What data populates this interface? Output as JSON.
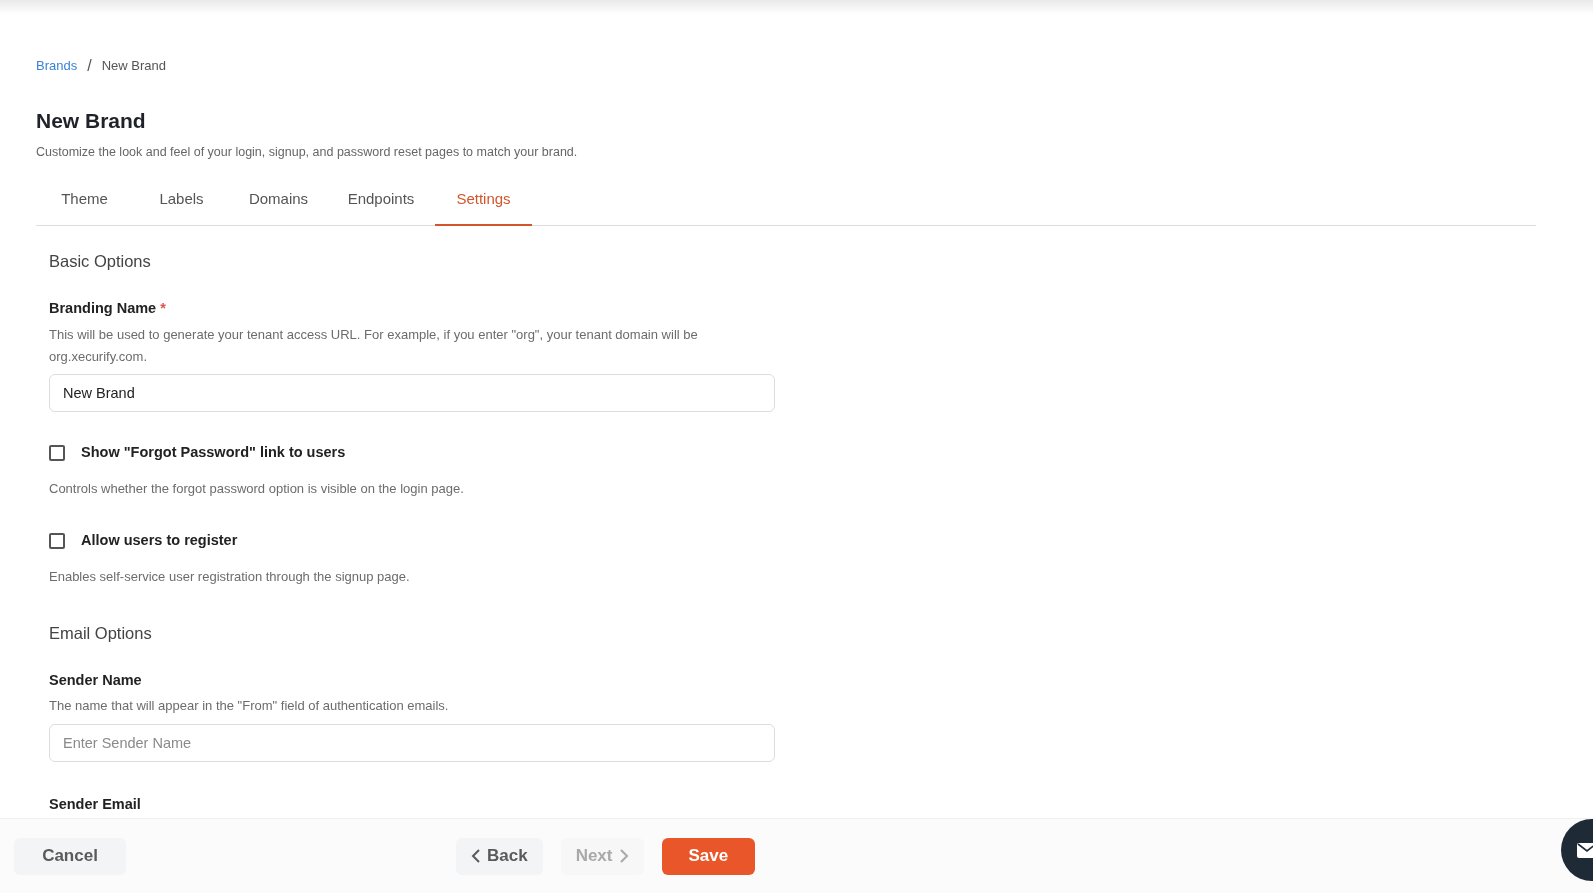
{
  "breadcrumb": [
    {
      "label": "Brands",
      "kind": "link"
    },
    {
      "label": "/",
      "kind": "separator"
    },
    {
      "label": "New Brand",
      "kind": "current"
    }
  ],
  "title": "New Brand",
  "subtitle": "Customize the look and feel of your login, signup, and password reset pages to match your brand.",
  "tabs": [
    {
      "label": "Theme",
      "selected": false
    },
    {
      "label": "Labels",
      "selected": false
    },
    {
      "label": "Domains",
      "selected": false
    },
    {
      "label": "Endpoints",
      "selected": false
    },
    {
      "label": "Settings",
      "selected": true
    }
  ],
  "sections": [
    {
      "heading": "Basic Options",
      "items": [
        {
          "kind": "text_field",
          "label": "Branding Name",
          "required_mark": "*",
          "description": "This will be used to generate your tenant access URL. For example, if you enter \"org\", your tenant domain will be org.xecurify.com.",
          "value": "New Brand"
        },
        {
          "kind": "checkbox",
          "label": "Show \"Forgot Password\" link to users",
          "checked": false,
          "description": "Controls whether the forgot password option is visible on the login page."
        },
        {
          "kind": "checkbox",
          "label": "Allow users to register",
          "checked": false,
          "description": "Enables self-service user registration through the signup page."
        }
      ]
    },
    {
      "heading": "Email Options",
      "items": [
        {
          "kind": "text_field",
          "label": "Sender Name",
          "description": "The name that will appear in the \"From\" field of authentication emails.",
          "placeholder": "Enter Sender Name"
        },
        {
          "kind": "text_field",
          "label": "Sender Email"
        }
      ]
    }
  ],
  "footer": {
    "buttons": [
      {
        "label": "Cancel",
        "kind": "cancel",
        "disabled": false
      },
      {
        "label": "Back",
        "kind": "back",
        "disabled": false
      },
      {
        "label": "Next",
        "kind": "next",
        "disabled": true
      },
      {
        "label": "Save",
        "kind": "save",
        "disabled": false
      }
    ]
  }
}
